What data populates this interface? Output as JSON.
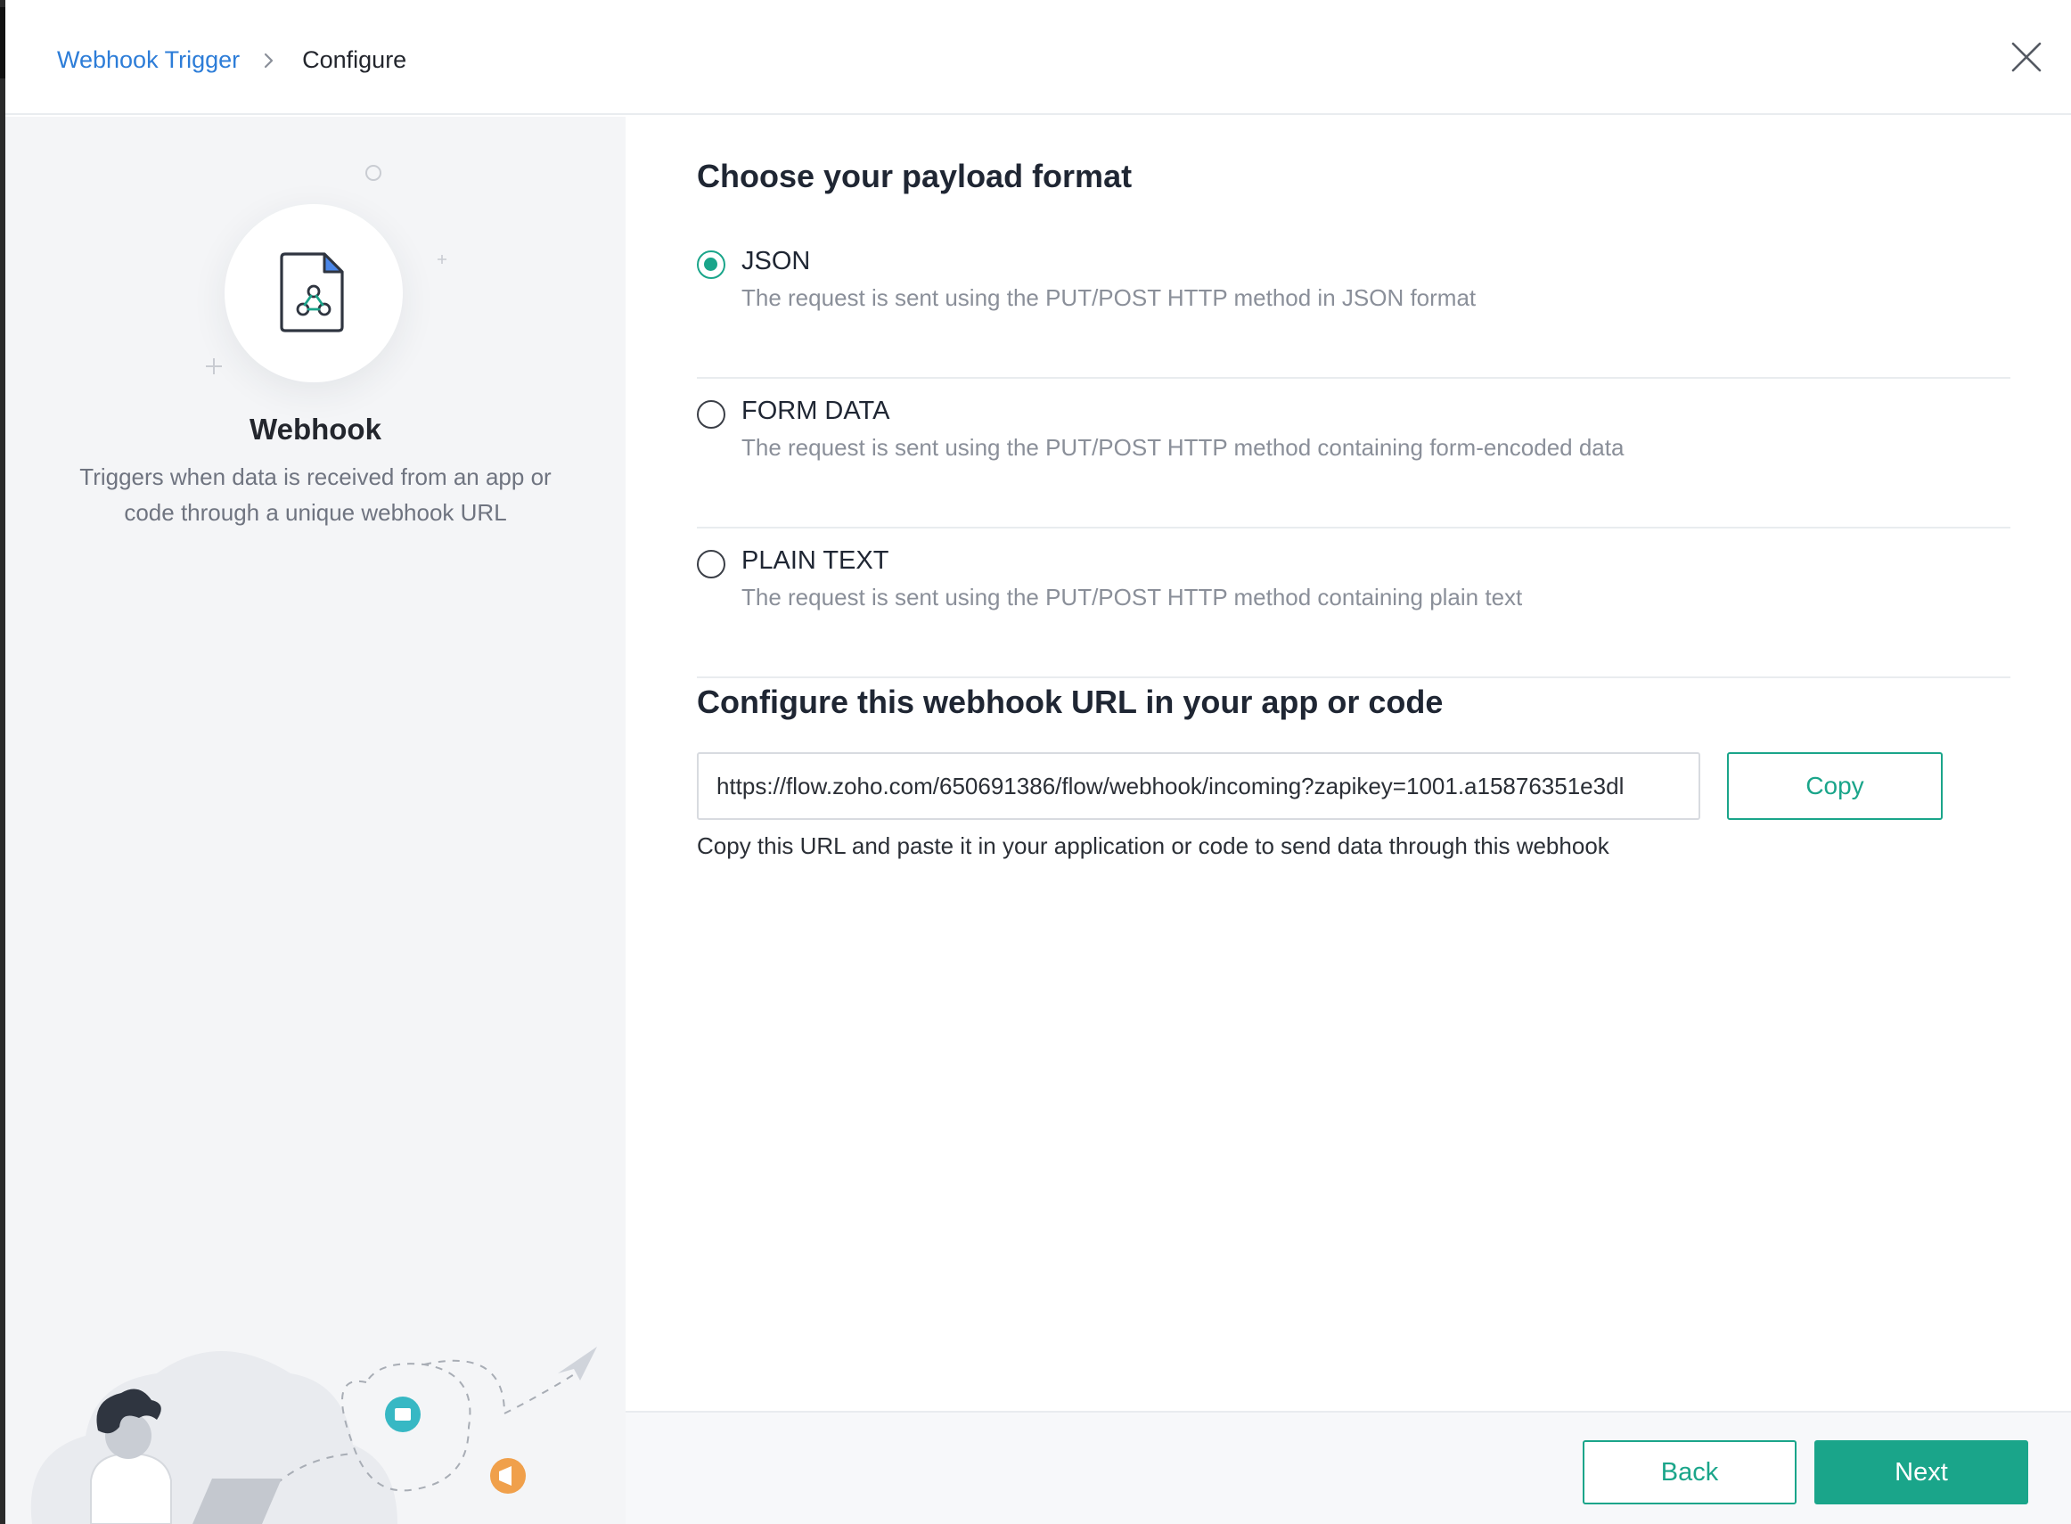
{
  "breadcrumb": {
    "parent": "Webhook Trigger",
    "current": "Configure"
  },
  "sidebar": {
    "title": "Webhook",
    "description": "Triggers when data is received from an app or code through a unique webhook URL"
  },
  "payload": {
    "title": "Choose your payload format",
    "selected": "json",
    "options": [
      {
        "id": "json",
        "label": "JSON",
        "description": "The request is sent using the PUT/POST HTTP method in JSON format"
      },
      {
        "id": "form",
        "label": "FORM DATA",
        "description": "The request is sent using the PUT/POST HTTP method containing form-encoded data"
      },
      {
        "id": "plain",
        "label": "PLAIN TEXT",
        "description": "The request is sent using the PUT/POST HTTP method containing plain text"
      }
    ]
  },
  "webhook_url": {
    "title": "Configure this webhook URL in your app or code",
    "value": "https://flow.zoho.com/650691386/flow/webhook/incoming?zapikey=1001.a15876351e3dl",
    "copy_label": "Copy",
    "hint": "Copy this URL and paste it in your application or code to send data through this webhook"
  },
  "footer": {
    "back_label": "Back",
    "next_label": "Next"
  },
  "colors": {
    "accent": "#1aa58a",
    "link": "#2d7dd8"
  }
}
